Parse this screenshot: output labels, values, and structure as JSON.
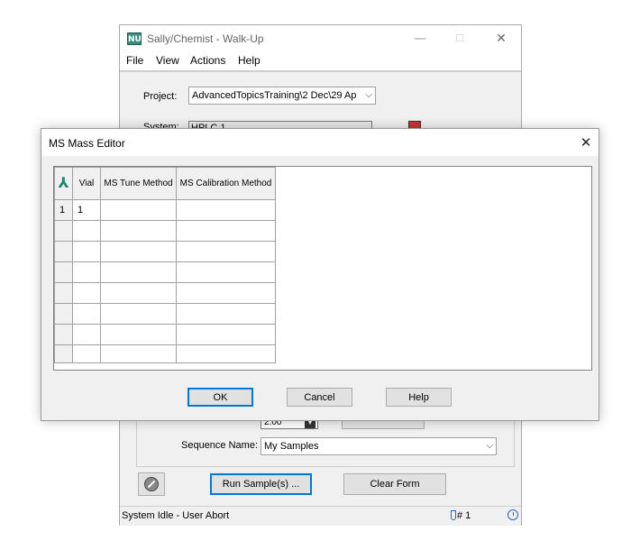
{
  "main_window": {
    "title": "Sally/Chemist - Walk-Up",
    "app_icon_text": "NU",
    "title_buttons": {
      "minimize": "—",
      "maximize": "☐",
      "close": "✕"
    },
    "menu": [
      "File",
      "View",
      "Actions",
      "Help"
    ],
    "project_label": "Project:",
    "project_value": "AdvancedTopicsTraining\\2 Dec\\29 Ap",
    "system_label": "System:",
    "system_value": "HPLC 1",
    "spin_value": "2.00",
    "sequence_label": "Sequence Name:",
    "sequence_value": "My Samples",
    "run_button": "Run Sample(s) ...",
    "clear_button": "Clear Form",
    "status_text": "System Idle - User Abort",
    "sample_count": "# 1"
  },
  "dialog": {
    "title": "MS Mass Editor",
    "close": "✕",
    "columns": [
      "Vial",
      "MS Tune Method",
      "MS Calibration Method"
    ],
    "corner_icon": "ms-spectrum-icon",
    "rows": [
      {
        "num": "1",
        "vial": "1",
        "tune": "",
        "cal": ""
      },
      {
        "num": "",
        "vial": "",
        "tune": "",
        "cal": ""
      },
      {
        "num": "",
        "vial": "",
        "tune": "",
        "cal": ""
      },
      {
        "num": "",
        "vial": "",
        "tune": "",
        "cal": ""
      },
      {
        "num": "",
        "vial": "",
        "tune": "",
        "cal": ""
      },
      {
        "num": "",
        "vial": "",
        "tune": "",
        "cal": ""
      },
      {
        "num": "",
        "vial": "",
        "tune": "",
        "cal": ""
      },
      {
        "num": "",
        "vial": "",
        "tune": "",
        "cal": ""
      }
    ],
    "ok": "OK",
    "cancel": "Cancel",
    "help": "Help"
  },
  "colors": {
    "accent": "#0078d7",
    "window_bg": "#f0f0f0",
    "icon_teal": "#1a8a6a"
  }
}
